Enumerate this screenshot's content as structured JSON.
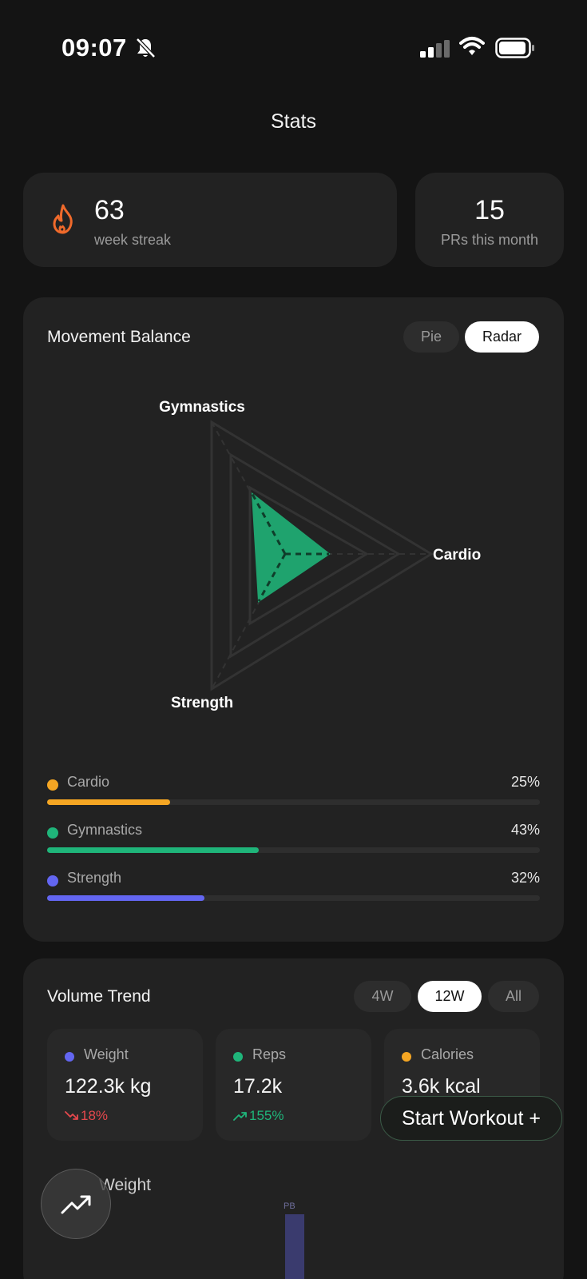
{
  "status_bar": {
    "time": "09:07"
  },
  "header": {
    "title": "Stats"
  },
  "streak": {
    "value": "63",
    "label": "week streak",
    "icon": "flame-icon"
  },
  "prs": {
    "value": "15",
    "label": "PRs this month"
  },
  "movement_balance": {
    "title": "Movement Balance",
    "toggle": {
      "options": [
        "Pie",
        "Radar"
      ],
      "selected": "Radar"
    },
    "radar_labels": {
      "gymnastics": "Gymnastics",
      "cardio": "Cardio",
      "strength": "Strength"
    },
    "items": [
      {
        "name": "Cardio",
        "percent": "25%",
        "value": 0.25,
        "color": "#f5a623"
      },
      {
        "name": "Gymnastics",
        "percent": "43%",
        "value": 0.43,
        "color": "#1fb57a"
      },
      {
        "name": "Strength",
        "percent": "32%",
        "value": 0.32,
        "color": "#6366f1"
      }
    ]
  },
  "volume_trend": {
    "title": "Volume Trend",
    "ranges": [
      "4W",
      "12W",
      "All"
    ],
    "selected_range": "12W",
    "metrics": [
      {
        "name": "Weight",
        "value": "122.3k kg",
        "change": "18%",
        "direction": "down",
        "color": "#6366f1",
        "change_color": "#e5484d"
      },
      {
        "name": "Reps",
        "value": "17.2k",
        "change": "155%",
        "direction": "up",
        "color": "#1fb57a",
        "change_color": "#1fb57a"
      },
      {
        "name": "Calories",
        "value": "3.6k kcal",
        "color": "#f5a623"
      }
    ],
    "chart_title": "Weight",
    "pb_label": "PB"
  },
  "actions": {
    "start_workout": "Start Workout +",
    "trend_icon": "trend-up-icon"
  }
}
